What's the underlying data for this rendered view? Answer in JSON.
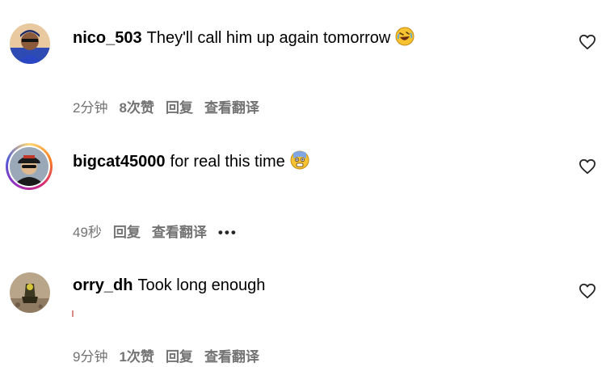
{
  "comments": [
    {
      "username": "nico_503",
      "text": "They'll call him up again tomorrow",
      "emoji_icon": "rolling-laughing-emoji",
      "time": "2分钟",
      "likes": "8次赞",
      "reply_label": "回复",
      "translate_label": "查看翻译",
      "liked": false
    },
    {
      "username": "bigcat45000",
      "text": "for real this time",
      "emoji_icon": "scared-face-emoji",
      "time": "49秒",
      "reply_label": "回复",
      "translate_label": "查看翻译",
      "more_label": "•••",
      "has_story_ring": true,
      "liked": false
    },
    {
      "username": "orry_dh",
      "text": "Took long enough",
      "time": "9分钟",
      "likes": "1次赞",
      "reply_label": "回复",
      "translate_label": "查看翻译",
      "liked": false
    }
  ],
  "colors": {
    "meta_text": "#737373",
    "heart_outline": "#262626"
  }
}
